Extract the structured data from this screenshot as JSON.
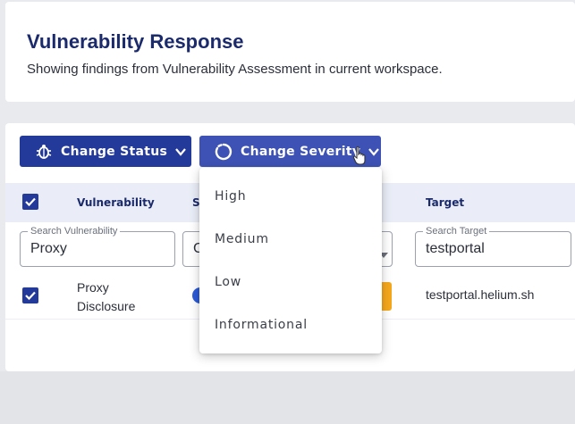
{
  "header": {
    "title": "Vulnerability Response",
    "subtitle": "Showing findings from Vulnerability Assessment in current workspace."
  },
  "toolbar": {
    "change_status_label": "Change Status",
    "change_severity_label": "Change Severity"
  },
  "table": {
    "columns": {
      "vulnerability": "Vulnerability",
      "status_partial": "S",
      "target": "Target"
    },
    "filters": {
      "vulnerability": {
        "label": "Search Vulnerability",
        "value": "Proxy"
      },
      "status_partial": {
        "value": "C"
      },
      "target": {
        "label": "Search Target",
        "value": "testportal"
      }
    },
    "rows": [
      {
        "vulnerability_line1": "Proxy",
        "vulnerability_line2": "Disclosure",
        "target": "testportal.helium.sh",
        "checked": true
      }
    ]
  },
  "severity_menu": {
    "options": [
      "High",
      "Medium",
      "Low",
      "Informational"
    ]
  },
  "colors": {
    "primary": "#243a9a",
    "primary_light": "#3d52b4",
    "title": "#1b2a6b",
    "badge_orange": "#f6a81b"
  }
}
